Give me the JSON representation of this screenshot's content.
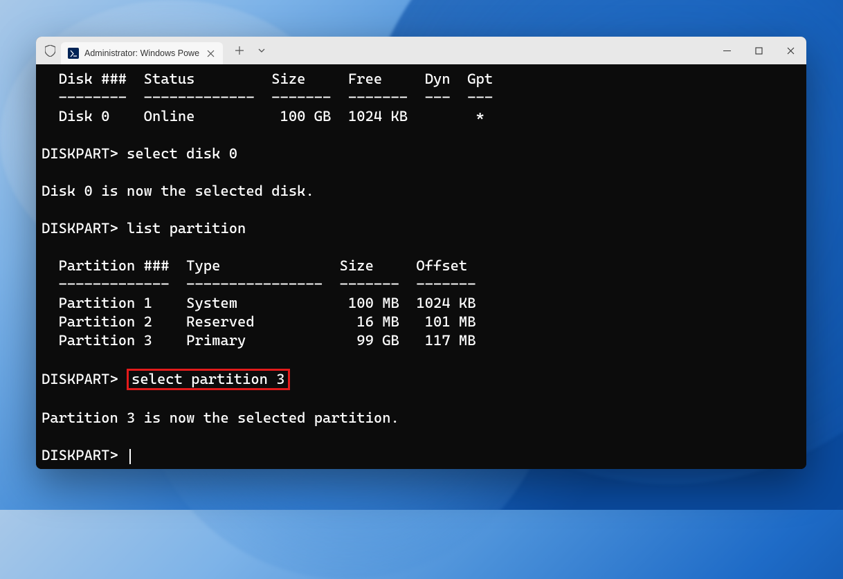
{
  "tab": {
    "title": "Administrator: Windows Powe"
  },
  "terminal": {
    "disk_header": "  Disk ###  Status         Size     Free     Dyn  Gpt",
    "disk_divider": "  --------  -------------  -------  -------  ---  ---",
    "disk_row": "  Disk 0    Online          100 GB  1024 KB        *",
    "prompt1": "DISKPART> ",
    "cmd1": "select disk 0",
    "response1": "Disk 0 is now the selected disk.",
    "prompt2": "DISKPART> ",
    "cmd2": "list partition",
    "part_header": "  Partition ###  Type              Size     Offset",
    "part_divider": "  -------------  ----------------  -------  -------",
    "part_row1": "  Partition 1    System             100 MB  1024 KB",
    "part_row2": "  Partition 2    Reserved            16 MB   101 MB",
    "part_row3": "  Partition 3    Primary             99 GB   117 MB",
    "prompt3": "DISKPART> ",
    "cmd3": "select partition 3",
    "response3": "Partition 3 is now the selected partition.",
    "prompt4": "DISKPART> "
  }
}
